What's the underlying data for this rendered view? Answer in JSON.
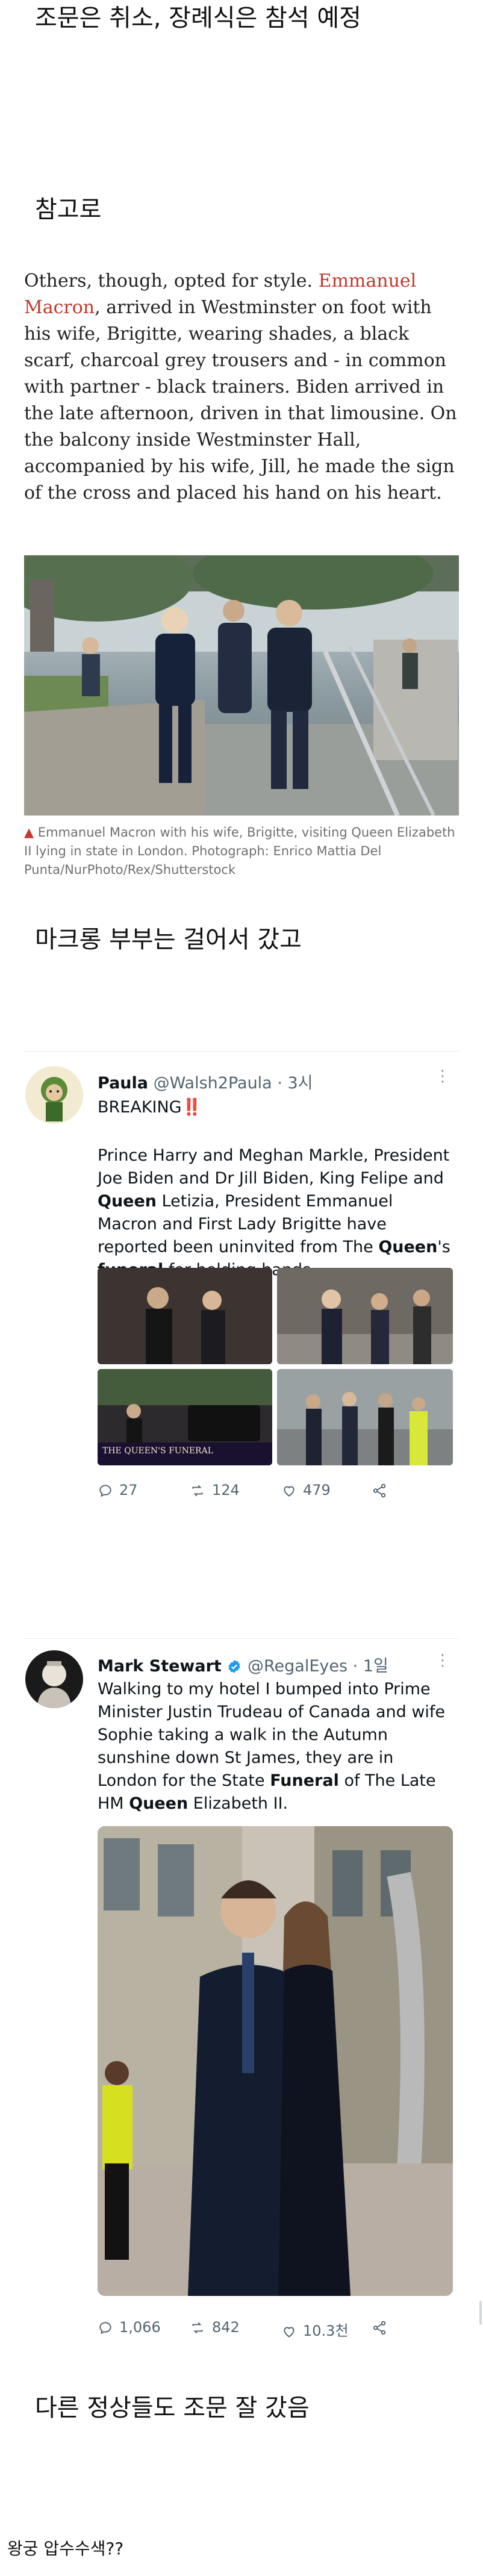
{
  "headings": {
    "title": "조문은 취소, 장례식은 참석 예정",
    "reference": "참고로",
    "walk": "마크롱 부부는 걸어서 갔고",
    "other_leaders": "다른 정상들도 조문 잘 갔음",
    "palace": "왕궁 압수수색??"
  },
  "article": {
    "p_before": "Others, though, opted for style. ",
    "link": "Emmanuel Macron",
    "p_after": ", arrived in Westminster on foot with his wife, Brigitte, wearing shades, a black scarf, charcoal grey trousers and - in common with partner - black trainers. Biden arrived in the late afternoon, driven in that limousine. On the balcony inside Westminster Hall, accompanied by his wife, Jill, he made the sign of the cross and placed his hand on his heart.",
    "caption": "Emmanuel Macron with his wife, Brigitte, visiting Queen Elizabeth II lying in state in London. Photograph: Enrico Mattia Del Punta/NurPhoto/Rex/Shutterstock"
  },
  "tweet1": {
    "name": "Paula",
    "handle": "@Walsh2Paula",
    "time": "· 3시",
    "line1": "BREAKING",
    "line1_mark": "‼️",
    "b1": "Prince Harry and Meghan Markle, President Joe Biden and Dr Jill Biden, King Felipe and ",
    "b2": "Queen",
    "b3": " Letizia, President Emmanuel Macron and First Lady Brigitte have reported been uninvited from The ",
    "b4": "Queen",
    "b5": "'s ",
    "b6": "funeral",
    "b7": " for holding hands.",
    "replies": "27",
    "retweets": "124",
    "likes": "479",
    "media_banner": "THE QUEEN'S FUNERAL"
  },
  "tweet2": {
    "name": "Mark Stewart",
    "handle": "@RegalEyes",
    "time": "· 1일",
    "b1": "Walking to my hotel I bumped into Prime Minister Justin Trudeau of Canada and wife Sophie taking a walk in the Autumn sunshine down St James, they are in London for the State ",
    "b2": "Funeral",
    "b3": " of The Late HM ",
    "b4": "Queen",
    "b5": " Elizabeth II.",
    "replies": "1,066",
    "retweets": "842",
    "likes": "10.3천"
  },
  "icons": {
    "caption": "red-triangle",
    "verified": "verified-badge-icon",
    "more": "more-icon",
    "reply": "reply-icon",
    "retweet": "retweet-icon",
    "like": "heart-icon",
    "share": "share-icon"
  },
  "colors": {
    "link": "#c0392b",
    "verified": "#1d9bf0",
    "muted": "#536471"
  }
}
